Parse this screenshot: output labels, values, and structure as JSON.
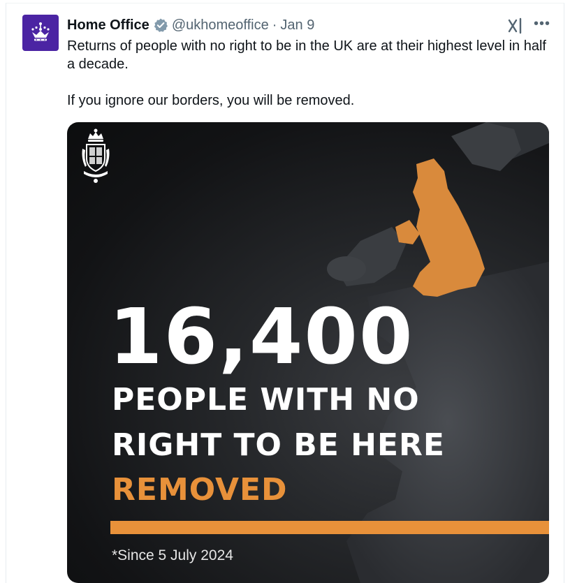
{
  "account": {
    "name": "Home Office",
    "handle": "@ukhomeoffice",
    "separator": "·",
    "date": "Jan 9"
  },
  "tweet": {
    "paragraph1": "Returns of people with no right to be in the UK are at their highest level in half a decade.",
    "paragraph2": "If you ignore our borders, you will be removed."
  },
  "media": {
    "number": "16,400",
    "line1": "PEOPLE WITH NO",
    "line2": "RIGHT TO BE HERE",
    "line3": "REMOVED",
    "footnote": "*Since 5 July 2024"
  },
  "icons": {
    "avatar": "crown-icon",
    "verified": "verified-badge-icon",
    "grok": "grok-icon",
    "more": "more-icon",
    "crest": "royal-crest-icon"
  },
  "colors": {
    "avatar_bg": "#4b24a3",
    "accent_orange": "#e8913a",
    "verified_gray": "#829aab"
  }
}
